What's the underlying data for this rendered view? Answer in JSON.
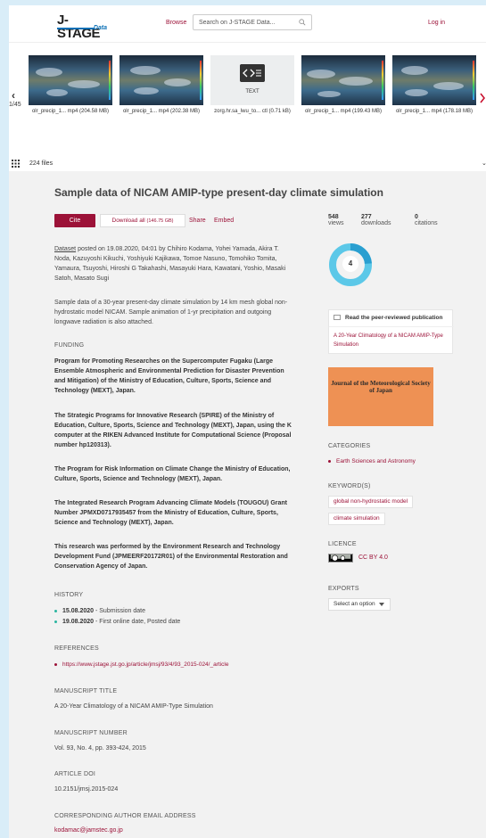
{
  "header": {
    "logo_main": "J-STAGE",
    "logo_sub": "Data",
    "browse": "Browse",
    "search_placeholder": "Search on J-STAGE Data...",
    "login": "Log in"
  },
  "carousel": {
    "counter": "1/45",
    "items": [
      {
        "caption": "olr_precip_1... mp4 (204.58 MB)",
        "kind": "video"
      },
      {
        "caption": "olr_precip_1... mp4 (202.38 MB)",
        "kind": "video"
      },
      {
        "caption": "zorg.hr.sa_lwu_to... ctl (0.71 kB)",
        "kind": "text",
        "label": "TEXT"
      },
      {
        "caption": "olr_precip_1... mp4 (199.43 MB)",
        "kind": "video"
      },
      {
        "caption": "olr_precip_1... mp4 (178.18 MB)",
        "kind": "video"
      }
    ]
  },
  "files": {
    "count": "224 files"
  },
  "item": {
    "title": "Sample data of NICAM AMIP-type present-day climate simulation",
    "cite": "Cite",
    "download": "Download all",
    "download_size": "(146.75 GB)",
    "share": "Share",
    "embed": "Embed",
    "posted_prefix": "Dataset",
    "posted": " posted on 19.08.2020, 04:01 by Chihiro Kodama, Yohei Yamada, Akira T. Noda, Kazuyoshi Kikuchi, Yoshiyuki Kajikawa, Tomoe Nasuno, Tomohiko Tomita, Yamaura, Tsuyoshi, Hiroshi G Takahashi, Masayuki Hara, Kawatani, Yoshio, Masaki Satoh, Masato Sugi",
    "description": "Sample data of a 30-year present-day climate simulation by 14 km mesh global non-hydrostatic model NICAM. Sample animation of 1-yr precipitation and outgoing longwave radiation is also attached."
  },
  "stats": {
    "views_num": "548",
    "views_label": "views",
    "downloads_num": "277",
    "downloads_label": "downloads",
    "citations_num": "0",
    "citations_label": "citations",
    "altmetric_score": "4"
  },
  "funding": {
    "heading": "FUNDING",
    "items": [
      "Program for Promoting Researches on the Supercomputer Fugaku (Large Ensemble Atmospheric and Environmental Prediction for Disaster Prevention and Mitigation) of the Ministry of Education, Culture, Sports, Science and Technology (MEXT), Japan.",
      "The Strategic Programs for Innovative Research (SPIRE) of the Ministry of Education, Culture, Sports, Science and Technology (MEXT), Japan, using the K computer at the RIKEN Advanced Institute for Computational Science (Proposal number hp120313).",
      "The Program for Risk Information on Climate Change the Ministry of Education, Culture, Sports, Science and Technology (MEXT), Japan.",
      "The Integrated Research Program Advancing Climate Models (TOUGOU) Grant Number JPMXD0717935457 from the Ministry of Education, Culture, Sports, Science and Technology (MEXT), Japan.",
      "This research was performed by the Environment Research and Technology Development Fund (JPMEERF20172R01) of the Environmental Restoration and Conservation Agency of Japan."
    ]
  },
  "history": {
    "heading": "HISTORY",
    "items": [
      {
        "date": "15.08.2020",
        "text": " - Submission date"
      },
      {
        "date": "19.08.2020",
        "text": " - First online date, Posted date"
      }
    ]
  },
  "references": {
    "heading": "REFERENCES",
    "link": "https://www.jstage.jst.go.jp/article/jmsj/93/4/93_2015-024/_article"
  },
  "manuscript_title": {
    "heading": "MANUSCRIPT TITLE",
    "value": "A 20-Year Climatology of a NICAM AMIP-Type Simulation"
  },
  "manuscript_number": {
    "heading": "MANUSCRIPT NUMBER",
    "value": "Vol. 93, No. 4, pp. 393-424, 2015"
  },
  "doi": {
    "heading": "ARTICLE DOI",
    "value": "10.2151/jmsj.2015-024"
  },
  "email": {
    "heading": "CORRESPONDING AUTHOR EMAIL ADDRESS",
    "value": "kodamac@jamstec.go.jp"
  },
  "sidebar": {
    "pub_heading": "Read the peer-reviewed publication",
    "pub_link": "A 20-Year Climatology of a NICAM AMIP-Type Simulation",
    "journal_title": "Journal of the Meteorological Society of Japan",
    "categories_heading": "CATEGORIES",
    "category": "Earth Sciences and Astronomy",
    "keywords_heading": "KEYWORD(S)",
    "keywords": [
      "global non-hydrostatic model",
      "climate simulation"
    ],
    "licence_heading": "LICENCE",
    "licence": "CC BY 4.0",
    "exports_heading": "EXPORTS",
    "exports_select": "Select an option"
  },
  "colors": {
    "accent": "#9c1238",
    "logo_blue": "#0a6fb5",
    "teal": "#2bb5a0",
    "journal_orange": "#ee9154"
  }
}
